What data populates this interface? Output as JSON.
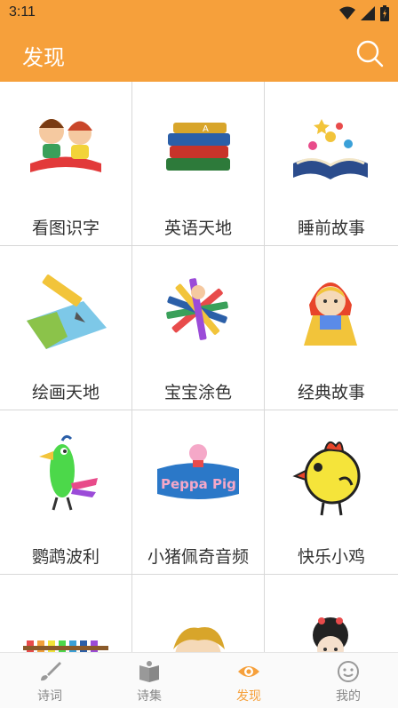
{
  "status_bar": {
    "time": "3:11",
    "icons": [
      "wifi-icon",
      "signal-icon",
      "battery-icon"
    ]
  },
  "app_bar": {
    "title": "发现",
    "search_icon": "search-icon"
  },
  "accent_color": "#f6a03b",
  "grid_items": [
    {
      "label": "看图识字",
      "icon": "kids-reading-icon"
    },
    {
      "label": "英语天地",
      "icon": "books-stack-icon"
    },
    {
      "label": "睡前故事",
      "icon": "storybook-icon"
    },
    {
      "label": "绘画天地",
      "icon": "pencil-drawing-icon"
    },
    {
      "label": "宝宝涂色",
      "icon": "crayons-icon"
    },
    {
      "label": "经典故事",
      "icon": "little-red-riding-hood-icon"
    },
    {
      "label": "鹦鹉波利",
      "icon": "parrot-icon"
    },
    {
      "label": "小猪佩奇音频",
      "icon": "peppa-pig-icon"
    },
    {
      "label": "快乐小鸡",
      "icon": "chick-icon"
    },
    {
      "label": "",
      "icon": "xylophone-icon"
    },
    {
      "label": "",
      "icon": "boy-cartoon-icon"
    },
    {
      "label": "",
      "icon": "chinese-girl-icon"
    }
  ],
  "bottom_nav": [
    {
      "label": "诗词",
      "icon": "brush-icon"
    },
    {
      "label": "诗集",
      "icon": "book-icon"
    },
    {
      "label": "发现",
      "icon": "eye-icon",
      "active": true
    },
    {
      "label": "我的",
      "icon": "smiley-icon"
    }
  ]
}
